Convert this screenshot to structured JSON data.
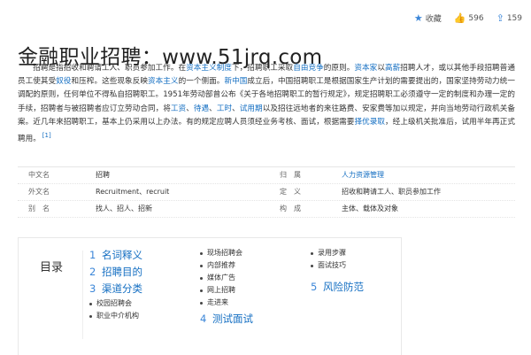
{
  "toolbar": {
    "favorite_label": "收藏",
    "like_count": "596",
    "share_count": "159"
  },
  "title": "金融职业招聘：www.51jrq.com",
  "paragraph": [
    {
      "t": "招聘是指招收和聘请工人、职员参加工作。在"
    },
    {
      "t": "资本主义制度",
      "link": true
    },
    {
      "t": "下，招聘职工采取"
    },
    {
      "t": "自由竞争",
      "link": true
    },
    {
      "t": "的原则。"
    },
    {
      "t": "资本家",
      "link": true
    },
    {
      "t": "以"
    },
    {
      "t": "高薪",
      "link": true
    },
    {
      "t": "招聘人才，或以其他手段招聘普通员工使其受"
    },
    {
      "t": "奴役",
      "link": true
    },
    {
      "t": "和压榨。这些现象反映"
    },
    {
      "t": "资本主义",
      "link": true
    },
    {
      "t": "的一个侧面。"
    },
    {
      "t": "新中国",
      "link": true
    },
    {
      "t": "成立后，中国招聘职工是根据国家生产计划的需要提出的，国家坚持劳动力统一调配的原则，任何单位不得私自招聘职工。1951年劳动部曾公布《关于各地招聘职工的暂行规定》，规定招聘职工必须遵守一定的制度和办理一定的手续，招聘者与被招聘者应订立劳动合同，将"
    },
    {
      "t": "工资",
      "link": true
    },
    {
      "t": "、"
    },
    {
      "t": "待遇",
      "link": true
    },
    {
      "t": "、"
    },
    {
      "t": "工时",
      "link": true
    },
    {
      "t": "、"
    },
    {
      "t": "试用期",
      "link": true
    },
    {
      "t": "以及招往远地者的来往路费、安家费等加以规定，并向当地劳动行政机关备案。近几年来招聘职工，基本上仍采用以上办法。有的规定应聘人员须经业务考核、面试，根据需要"
    },
    {
      "t": "择优录取",
      "link": true
    },
    {
      "t": "，经上级机关批准后，试用半年再正式聘用。"
    }
  ],
  "citation": "[1]",
  "infobox": [
    {
      "k1": "中文名",
      "v1": "招聘",
      "k2": "归　属",
      "v2": "人力资源管理",
      "v2_link": true
    },
    {
      "k1": "外文名",
      "v1": "Recruitment、recruit",
      "k2": "定　义",
      "v2": "招收和聘请工人、职员参加工作",
      "v2_link": false
    },
    {
      "k1": "别　名",
      "v1": "找人、招人、招新",
      "k2": "构　成",
      "v2": "主体、载体及对象",
      "v2_link": false
    }
  ],
  "toc": {
    "title": "目录",
    "columns": [
      [
        {
          "level": 1,
          "num": "1",
          "label": "名词释义"
        },
        {
          "level": 1,
          "num": "2",
          "label": "招聘目的"
        },
        {
          "level": 1,
          "num": "3",
          "label": "渠道分类"
        },
        {
          "level": 2,
          "label": "校园招聘会"
        },
        {
          "level": 2,
          "label": "职业中介机构"
        }
      ],
      [
        {
          "level": 2,
          "label": "现场招聘会"
        },
        {
          "level": 2,
          "label": "内部推荐"
        },
        {
          "level": 2,
          "label": "媒体广告"
        },
        {
          "level": 2,
          "label": "网上招聘"
        },
        {
          "level": 2,
          "label": "走进来"
        },
        {
          "level": 1,
          "num": "4",
          "label": "测试面试"
        }
      ],
      [
        {
          "level": 2,
          "label": "录用步骤"
        },
        {
          "level": 2,
          "label": "面试技巧"
        },
        {
          "level": 1,
          "num": "5",
          "label": "风险防范"
        }
      ]
    ]
  },
  "icons": {
    "favorite": "star-icon",
    "like": "thumbs-up-icon",
    "share": "share-icon"
  },
  "colors": {
    "link": "#136ec2",
    "icon": "#3b86d8"
  }
}
